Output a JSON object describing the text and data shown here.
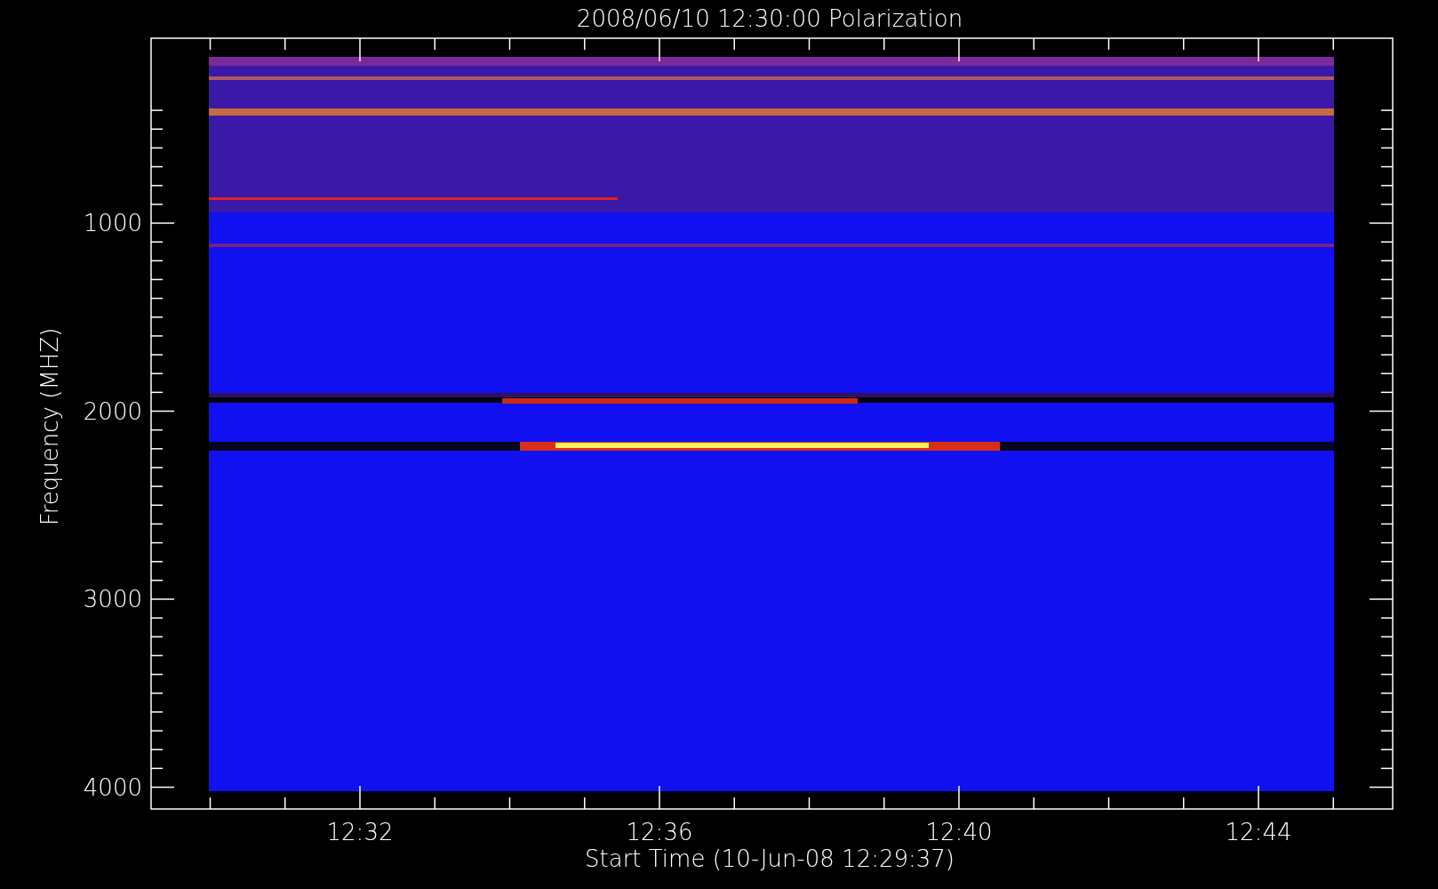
{
  "title": "2008/06/10 12:30:00 Polarization",
  "y_axis": {
    "label": "Frequency (MHZ)",
    "ticks": [
      "1000",
      "2000",
      "3000",
      "4000"
    ]
  },
  "x_axis": {
    "label": "Start Time (10-Jun-08 12:29:37)",
    "ticks": [
      "12:32",
      "12:36",
      "12:40",
      "12:44"
    ]
  }
}
